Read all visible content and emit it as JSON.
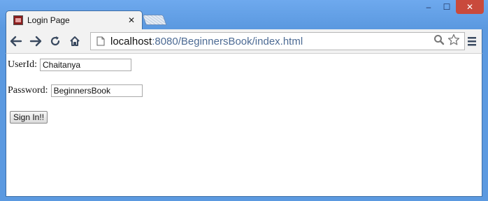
{
  "browser": {
    "tab_title": "Login Page",
    "tab_close_glyph": "✕",
    "url_host": "localhost",
    "url_rest": ":8080/BeginnersBook/index.html",
    "window_controls": {
      "minimize": "–",
      "maximize": "☐",
      "close": "✕"
    }
  },
  "form": {
    "userid_label": "UserId:",
    "userid_value": "Chaitanya",
    "password_label": "Password:",
    "password_value": "BeginnersBook",
    "submit_label": "Sign In!!"
  },
  "icons": {
    "back": "back-arrow-icon",
    "forward": "forward-arrow-icon",
    "reload": "reload-icon",
    "home": "home-icon",
    "page": "page-icon",
    "search": "search-icon",
    "bookmark": "star-icon",
    "menu": "hamburger-menu-icon"
  },
  "colors": {
    "frame": "#5d9ce3",
    "close_button": "#c94a3c",
    "url_path": "#4d6b94"
  }
}
